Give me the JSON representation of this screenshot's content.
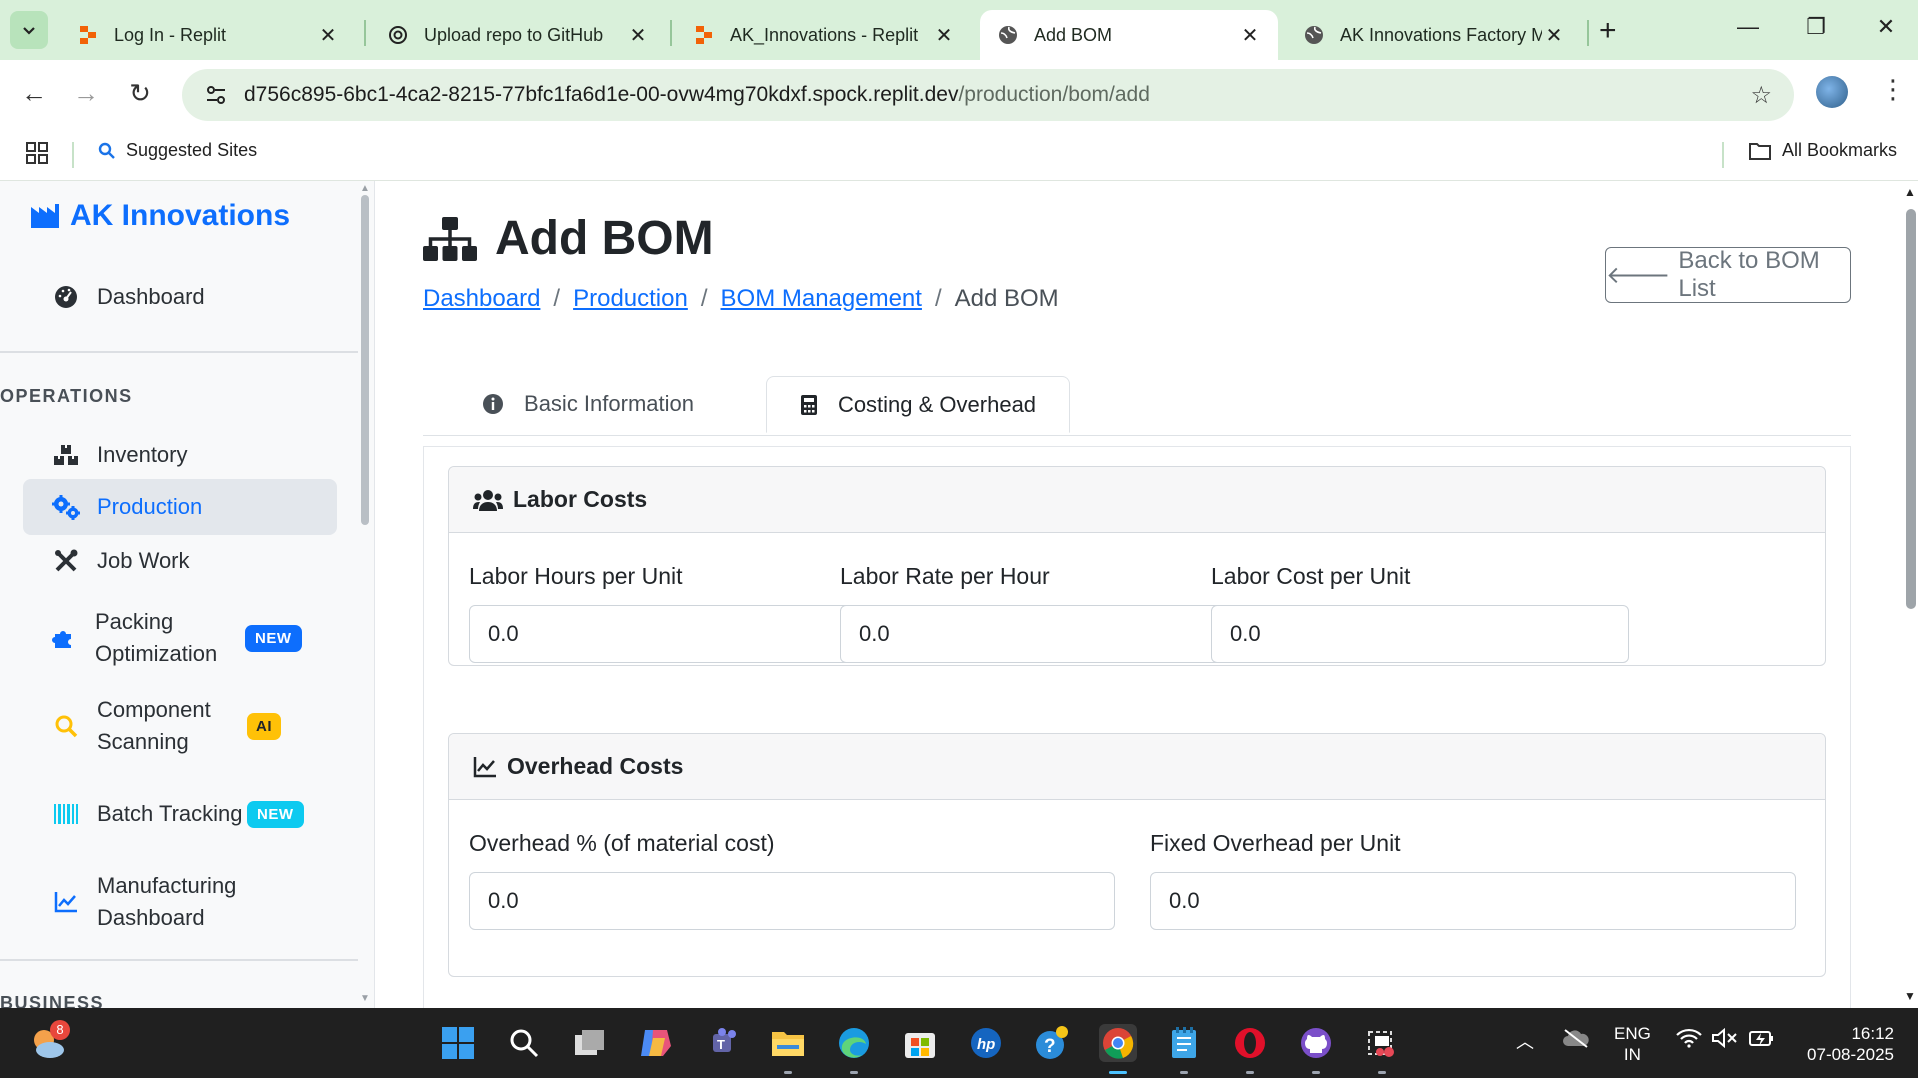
{
  "browser": {
    "tabs": [
      {
        "title": "Log In - Replit",
        "favicon": "replit-icon"
      },
      {
        "title": "Upload repo to GitHub",
        "favicon": "openai-icon"
      },
      {
        "title": "AK_Innovations - Replit",
        "favicon": "replit-icon"
      },
      {
        "title": "Add BOM",
        "favicon": "globe-icon"
      },
      {
        "title": "AK Innovations Factory M",
        "favicon": "globe-icon"
      }
    ],
    "active_tab_index": 3,
    "url_host": "d756c895-6bc1-4ca2-8215-77bfc1fa6d1e-00-ovw4mg70kdxf.spock.replit.dev",
    "url_path": "/production/bom/add",
    "bookmarks": {
      "suggested": "Suggested Sites",
      "all": "All Bookmarks"
    }
  },
  "sidebar": {
    "brand": "AK Innovations",
    "dashboard": "Dashboard",
    "section_operations": "OPERATIONS",
    "items": [
      {
        "label": "Inventory",
        "icon": "boxes-icon"
      },
      {
        "label": "Production",
        "icon": "cogs-icon",
        "active": true
      },
      {
        "label": "Job Work",
        "icon": "tools-icon"
      },
      {
        "label": "Packing Optimization",
        "icon": "puzzle-icon",
        "badge": "NEW"
      },
      {
        "label": "Component Scanning",
        "icon": "search-icon",
        "badge": "AI"
      },
      {
        "label": "Batch Tracking",
        "icon": "barcode-icon",
        "badge": "NEW"
      },
      {
        "label": "Manufacturing Dashboard",
        "icon": "chart-line-icon"
      }
    ],
    "section_business": "BUSINESS"
  },
  "main": {
    "title": "Add BOM",
    "breadcrumb": [
      "Dashboard",
      "Production",
      "BOM Management",
      "Add BOM"
    ],
    "back_button": "Back to BOM List",
    "tabs": [
      "Basic Information",
      "Costing & Overhead"
    ],
    "active_tab": 1,
    "labor": {
      "title": "Labor Costs",
      "fields": [
        {
          "label": "Labor Hours per Unit",
          "value": "0.0"
        },
        {
          "label": "Labor Rate per Hour",
          "value": "0.0"
        },
        {
          "label": "Labor Cost per Unit",
          "value": "0.0"
        }
      ]
    },
    "overhead": {
      "title": "Overhead Costs",
      "fields": [
        {
          "label": "Overhead % (of material cost)",
          "value": "0.0"
        },
        {
          "label": "Fixed Overhead per Unit",
          "value": "0.0"
        }
      ]
    }
  },
  "taskbar": {
    "notification_count": "8",
    "lang_line1": "ENG",
    "lang_line2": "IN",
    "time": "16:12",
    "date": "07-08-2025"
  },
  "colors": {
    "primary": "#0d6efd",
    "chrome_bg": "#d9f0da",
    "badge_ai": "#ffc107"
  }
}
